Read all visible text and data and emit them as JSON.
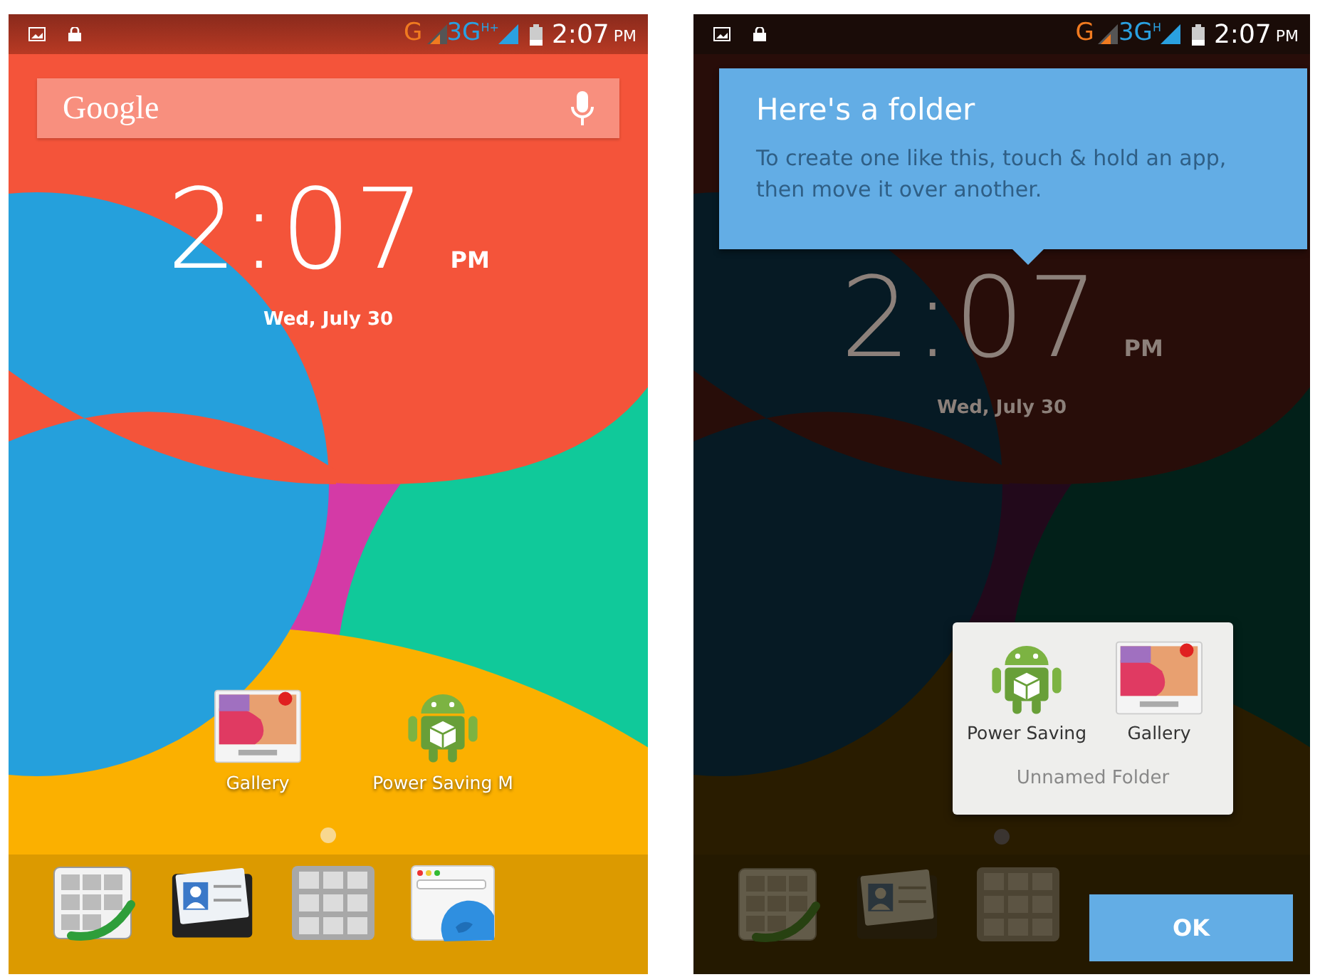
{
  "screens": [
    {
      "dimmed": false,
      "status_bar": {
        "carrier_g": "G",
        "carrier_3g": "3G",
        "carrier_h": "H+",
        "time": "2:07",
        "ampm": "PM"
      },
      "search": {
        "logo": "Google"
      },
      "clock": {
        "time": "2:07",
        "ampm": "PM",
        "date": "Wed, July 30"
      },
      "apps": [
        {
          "kind": "gallery",
          "label": "Gallery"
        },
        {
          "kind": "android",
          "label": "Power Saving M"
        }
      ],
      "page_dots": [
        {
          "selected": true
        }
      ],
      "dock": [
        {
          "kind": "dialer"
        },
        {
          "kind": "contacts"
        },
        {
          "kind": "apps"
        },
        {
          "kind": "browser"
        }
      ]
    },
    {
      "dimmed": true,
      "status_bar": {
        "carrier_g": "G",
        "carrier_3g": "3G",
        "carrier_h": "H",
        "time": "2:07",
        "ampm": "PM"
      },
      "clock": {
        "time": "2:07",
        "ampm": "PM",
        "date": "Wed, July 30"
      },
      "page_dots": [
        {
          "selected": true
        }
      ],
      "dock": [
        {
          "kind": "dialer"
        },
        {
          "kind": "contacts"
        },
        {
          "kind": "apps"
        }
      ],
      "tooltip": {
        "title": "Here's a folder",
        "text": "To create one like this, touch & hold an app, then move it over another."
      },
      "folder": {
        "apps": [
          {
            "kind": "android",
            "label": "Power Saving"
          },
          {
            "kind": "gallery",
            "label": "Gallery"
          }
        ],
        "name": "Unnamed Folder"
      },
      "ok_button": "OK"
    }
  ]
}
